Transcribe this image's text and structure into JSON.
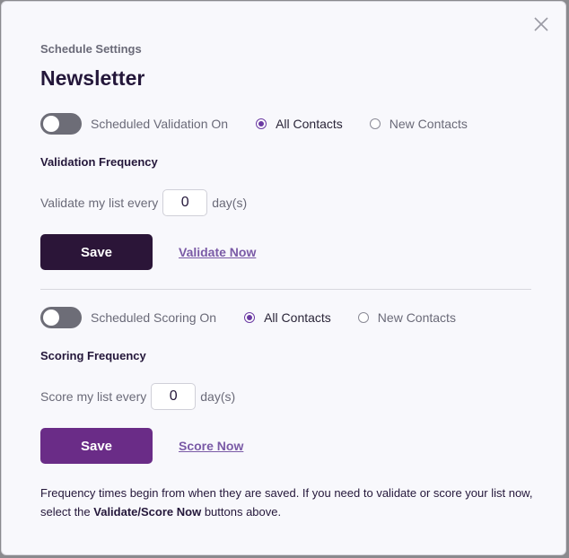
{
  "header": {
    "eyebrow": "Schedule Settings",
    "title": "Newsletter"
  },
  "validation": {
    "toggle_label": "Scheduled Validation On",
    "toggle_on": false,
    "radio_all": "All Contacts",
    "radio_new": "New Contacts",
    "selected": "All Contacts",
    "heading": "Validation Frequency",
    "freq_prefix": "Validate my list every",
    "freq_value": "0",
    "freq_suffix": "day(s)",
    "save_label": "Save",
    "now_link": "Validate Now"
  },
  "scoring": {
    "toggle_label": "Scheduled Scoring On",
    "toggle_on": false,
    "radio_all": "All Contacts",
    "radio_new": "New Contacts",
    "selected": "All Contacts",
    "heading": "Scoring Frequency",
    "freq_prefix": "Score my list every",
    "freq_value": "0",
    "freq_suffix": "day(s)",
    "save_label": "Save",
    "now_link": "Score Now"
  },
  "footnote": {
    "part1": "Frequency times begin from when they are saved. If you need to validate or score your list now, select the ",
    "bold": "Validate/Score Now",
    "part2": " buttons above."
  },
  "colors": {
    "accent": "#6b3aa3",
    "save_dark": "#2b1538",
    "save_purple": "#6a2c87",
    "link": "#7a5aa6"
  },
  "icons": {
    "close": "close-icon"
  }
}
